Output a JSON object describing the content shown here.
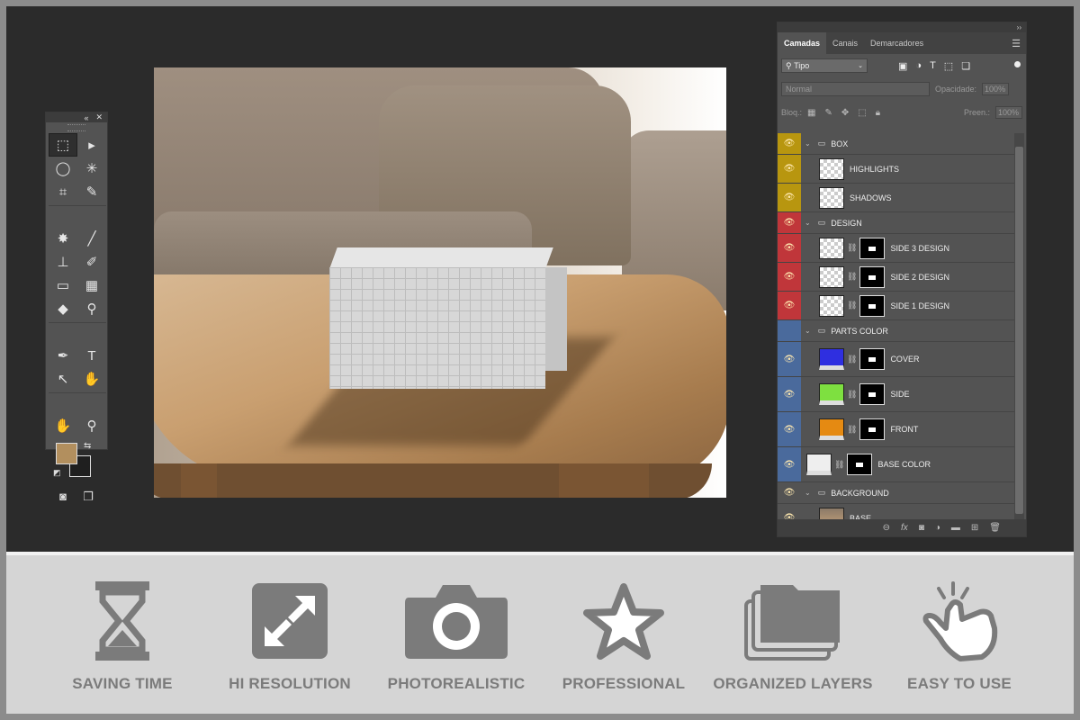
{
  "toolbar": {
    "head_collapse": "«",
    "head_close": "✕",
    "tools": [
      "⬚",
      "▸",
      "◯",
      "✳",
      "⌗",
      "✎",
      "✸",
      "╱",
      "⊥",
      "✐",
      "▭",
      "▦",
      "◆",
      "⚲",
      "✒",
      "T",
      "↖",
      "✋",
      "✋",
      "⚲"
    ],
    "fg_color": "#b28f5e",
    "bg_color": "#1f1f1f"
  },
  "layers_panel": {
    "tabs": [
      "Camadas",
      "Canais",
      "Demarcadores"
    ],
    "filter_label": "Tipo",
    "blend_mode": "Normal",
    "opacity_label": "Opacidade:",
    "opacity_value": "100%",
    "lock_label": "Bloq.:",
    "fill_label": "Preen.:",
    "fill_value": "100%",
    "layers": [
      {
        "name": "BOX",
        "type": "group",
        "color": "#b8960f",
        "visible": true
      },
      {
        "name": "HIGHLIGHTS",
        "type": "layer",
        "color": "#b8960f",
        "visible": true
      },
      {
        "name": "SHADOWS",
        "type": "layer",
        "color": "#b8960f",
        "visible": true
      },
      {
        "name": "DESIGN",
        "type": "group",
        "color": "#c0363a",
        "visible": true
      },
      {
        "name": "SIDE 3 DESIGN",
        "type": "smart",
        "color": "#c0363a",
        "visible": true
      },
      {
        "name": "SIDE 2 DESIGN",
        "type": "smart",
        "color": "#c0363a",
        "visible": true
      },
      {
        "name": "SIDE 1 DESIGN",
        "type": "smart",
        "color": "#c0363a",
        "visible": true
      },
      {
        "name": "PARTS COLOR",
        "type": "group",
        "color": "#4a6a9c",
        "visible": false
      },
      {
        "name": "COVER",
        "type": "fill",
        "color": "#4a6a9c",
        "fill": "#2f2fe0",
        "visible": true
      },
      {
        "name": "SIDE",
        "type": "fill",
        "color": "#4a6a9c",
        "fill": "#7ee040",
        "visible": true
      },
      {
        "name": "FRONT",
        "type": "fill",
        "color": "#4a6a9c",
        "fill": "#e58a12",
        "visible": true
      },
      {
        "name": "BASE COLOR",
        "type": "fill",
        "color": "#4a6a9c",
        "fill": "#eeeeee",
        "visible": true
      },
      {
        "name": "BACKGROUND",
        "type": "group",
        "color": "#535353",
        "visible": true
      },
      {
        "name": "BASE",
        "type": "photo",
        "color": "#535353",
        "visible": true
      }
    ]
  },
  "features": [
    {
      "label": "SAVING TIME",
      "icon": "hourglass-icon"
    },
    {
      "label": "HI RESOLUTION",
      "icon": "expand-arrows-icon"
    },
    {
      "label": "PHOTOREALISTIC",
      "icon": "camera-icon"
    },
    {
      "label": "PROFESSIONAL",
      "icon": "star-icon"
    },
    {
      "label": "ORGANIZED LAYERS",
      "icon": "stacked-folders-icon"
    },
    {
      "label": "EASY TO USE",
      "icon": "tapping-hand-icon"
    }
  ]
}
